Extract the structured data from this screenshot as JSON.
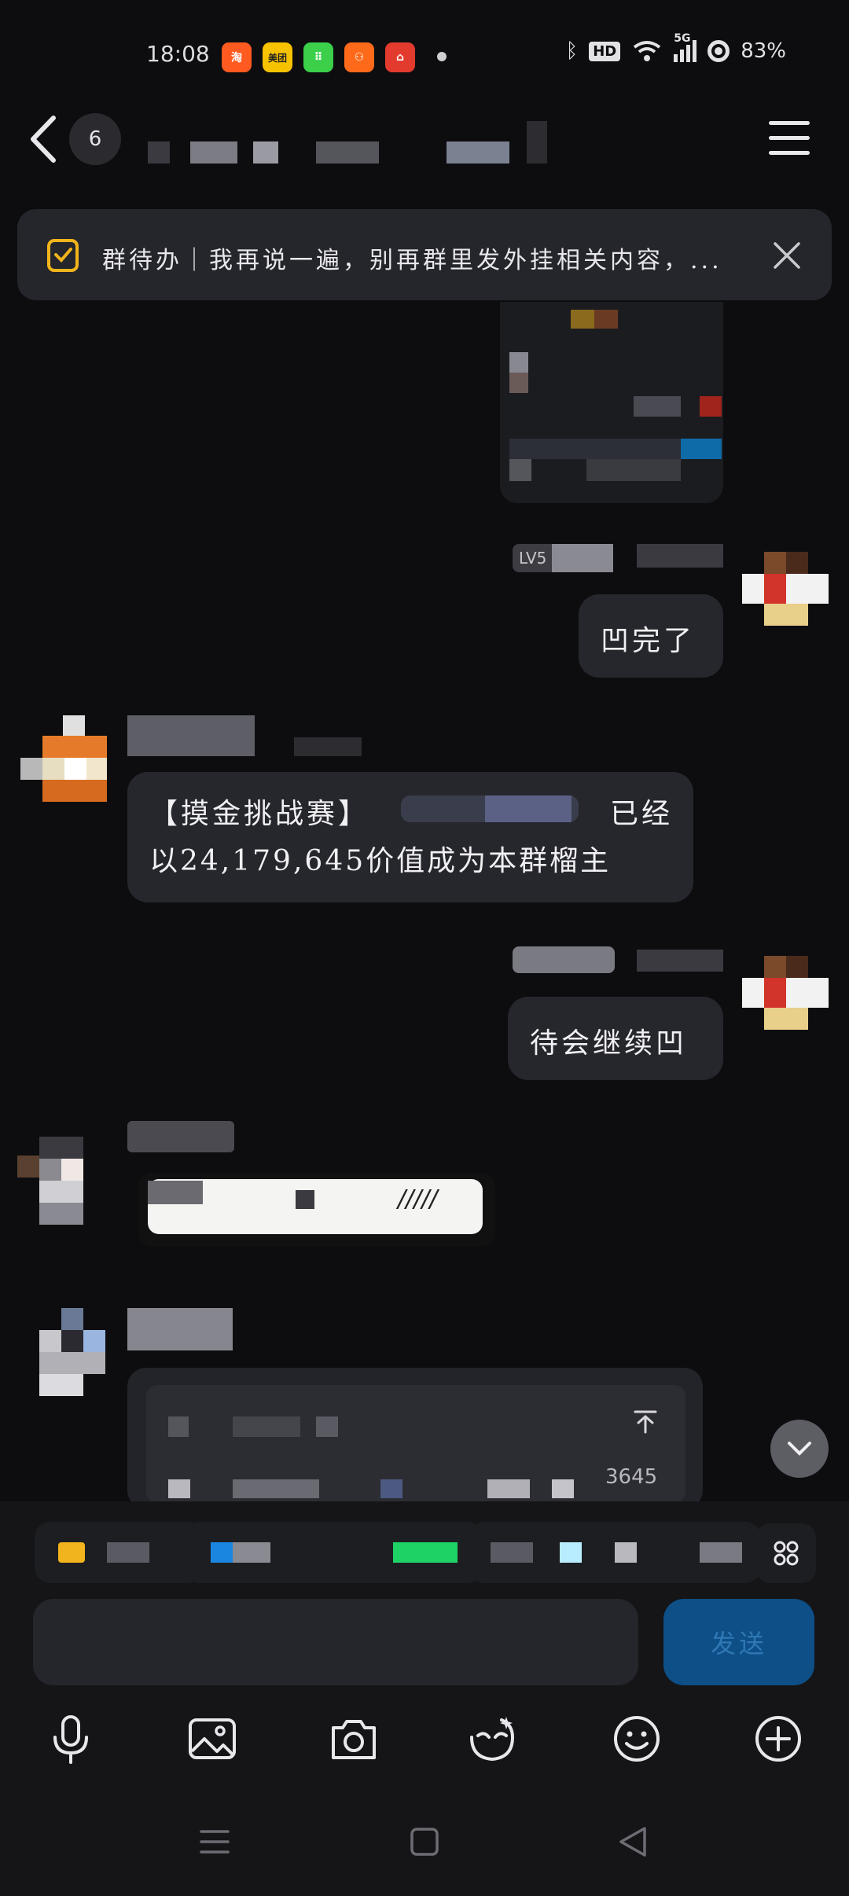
{
  "status_bar": {
    "time": "18:08",
    "apps": [
      {
        "name": "taobao-icon",
        "glyph": "淘",
        "color": "#ff5a1f"
      },
      {
        "name": "meituan-icon",
        "glyph": "美团",
        "color": "#f7c200"
      },
      {
        "name": "app-green-icon",
        "glyph": "⠿",
        "color": "#3bcf4a"
      },
      {
        "name": "kuaishou-icon",
        "glyph": "⚇",
        "color": "#ff6a1a"
      },
      {
        "name": "app-red-icon",
        "glyph": "⌂",
        "color": "#e23b2e"
      }
    ],
    "network": "5G",
    "hd": "HD",
    "battery": "83%"
  },
  "header": {
    "unread_count": "6"
  },
  "todo_banner": {
    "text": "群待办｜我再说一遍，别再群里发外挂相关内容，..."
  },
  "messages": {
    "own_level_badge": "LV5",
    "own_msg_1": "凹完了",
    "bot_msg_line1_prefix": "【摸金挑战赛】",
    "bot_msg_line1_suffix": "已经",
    "bot_msg_line2": "以24,179,645价值成为本群榴主",
    "own_msg_2": "待会继续凹",
    "sticker_text": "/////",
    "quote_value_fragment": "3645"
  },
  "composer": {
    "input_placeholder": "",
    "send_label": "发送"
  },
  "colors": {
    "background": "#0d0d10",
    "bubble": "#26272c",
    "send_button": "#0d4f86",
    "accent_todo": "#f2b41c"
  }
}
